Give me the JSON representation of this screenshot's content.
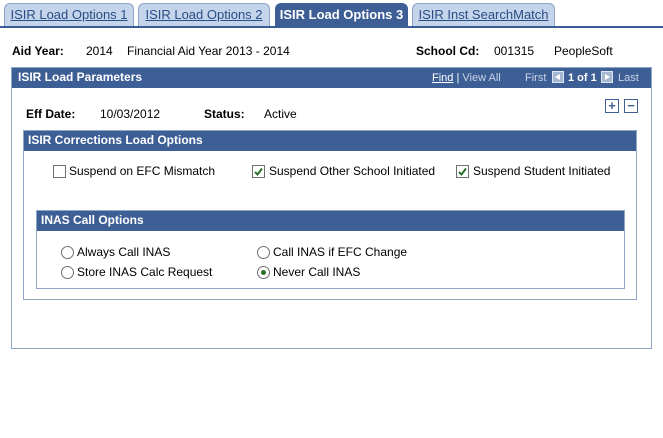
{
  "tabs": [
    {
      "label": "ISIR Load Options 1",
      "active": false
    },
    {
      "label": "ISIR Load Options 2",
      "active": false
    },
    {
      "label": "ISIR Load Options 3",
      "active": true
    },
    {
      "label": "ISIR Inst SearchMatch",
      "active": false
    }
  ],
  "header": {
    "aid_year_label": "Aid Year:",
    "aid_year_value": "2014",
    "aid_year_desc": "Financial Aid Year 2013 - 2014",
    "school_cd_label": "School Cd:",
    "school_cd_value": "001315",
    "school_cd_desc": "PeopleSoft"
  },
  "load_params": {
    "title": "ISIR Load Parameters",
    "find_label": "Find",
    "separator": "|",
    "view_all_label": "View All",
    "first_label": "First",
    "range_text": "1 of 1",
    "last_label": "Last",
    "eff_date_label": "Eff Date:",
    "eff_date_value": "10/03/2012",
    "status_label": "Status:",
    "status_value": "Active",
    "add_row": "+",
    "delete_row": "−"
  },
  "corrections": {
    "title": "ISIR Corrections Load Options",
    "options": [
      {
        "label": "Suspend on EFC Mismatch",
        "checked": false
      },
      {
        "label": "Suspend Other School Initiated",
        "checked": true
      },
      {
        "label": "Suspend Student Initiated",
        "checked": true
      }
    ]
  },
  "inas": {
    "title": "INAS Call Options",
    "options": [
      {
        "label": "Always Call INAS",
        "selected": false
      },
      {
        "label": "Call INAS if EFC Change",
        "selected": false
      },
      {
        "label": "Store INAS Calc Request",
        "selected": false
      },
      {
        "label": "Never Call INAS",
        "selected": true
      }
    ]
  },
  "colors": {
    "header_blue": "#3e5f96",
    "tab_inactive": "#c3d4eb",
    "border": "#8fa6c6",
    "check_green": "#2a6f2a"
  }
}
